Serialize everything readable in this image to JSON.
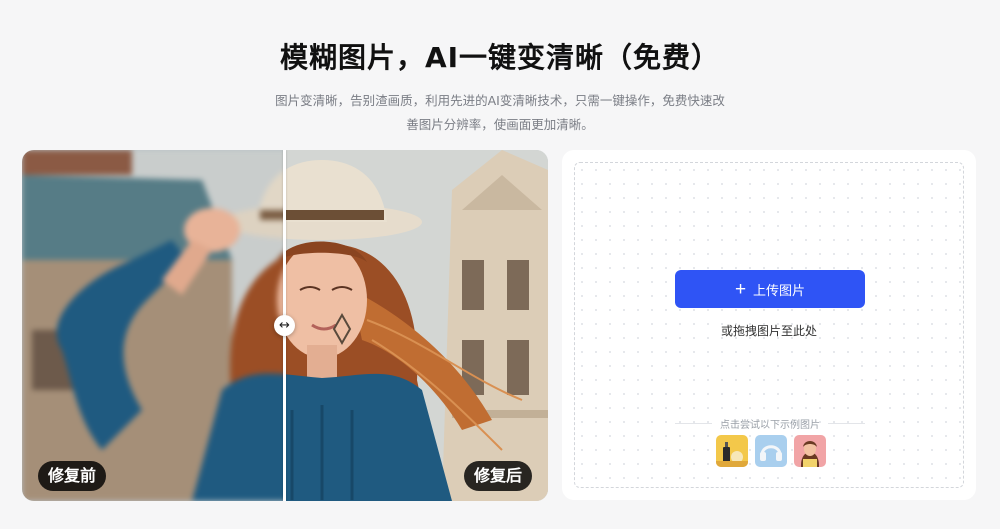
{
  "header": {
    "title": "模糊图片，AI一键变清晰（免费）",
    "subtitle": "图片变清晰，告别渣画质，利用先进的AI变清晰技术，只需一键操作，免费快速改善图片分辨率，使画面更加清晰。"
  },
  "compare": {
    "before_label": "修复前",
    "after_label": "修复后",
    "handle_icon": "↔"
  },
  "upload": {
    "button_icon": "+",
    "button_label": "上传图片",
    "drag_hint": "或拖拽图片至此处",
    "samples_label": "点击尝试以下示例图片",
    "samples": [
      {
        "icon": "cosmetics-sample"
      },
      {
        "icon": "headphones-sample"
      },
      {
        "icon": "portrait-sample"
      }
    ]
  }
}
